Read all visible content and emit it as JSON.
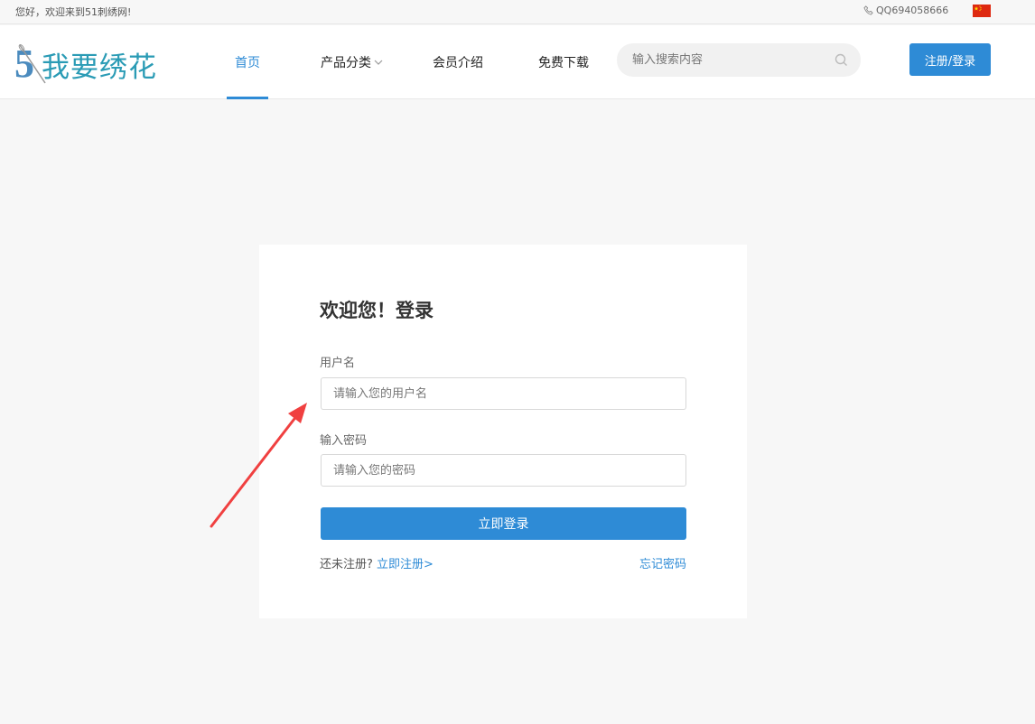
{
  "topbar": {
    "welcome": "您好，欢迎来到51刺绣网!",
    "qq": "QQ694058666"
  },
  "header": {
    "logo_num": "5",
    "logo_text": "我要绣花",
    "nav": [
      {
        "label": "首页",
        "active": true
      },
      {
        "label": "产品分类",
        "dropdown": true
      },
      {
        "label": "会员介绍"
      },
      {
        "label": "免费下载"
      }
    ],
    "search_placeholder": "输入搜索内容",
    "register_login": "注册/登录"
  },
  "login": {
    "title": "欢迎您！登录",
    "username_label": "用户名",
    "username_placeholder": "请输入您的用户名",
    "password_label": "输入密码",
    "password_placeholder": "请输入您的密码",
    "submit": "立即登录",
    "not_registered": "还未注册?",
    "register_link": "立即注册>",
    "forgot": "忘记密码"
  },
  "colors": {
    "accent": "#2e8bd6",
    "logo": "#2a9bb5",
    "annotation_arrow": "#f04040",
    "background": "#f7f7f7"
  }
}
